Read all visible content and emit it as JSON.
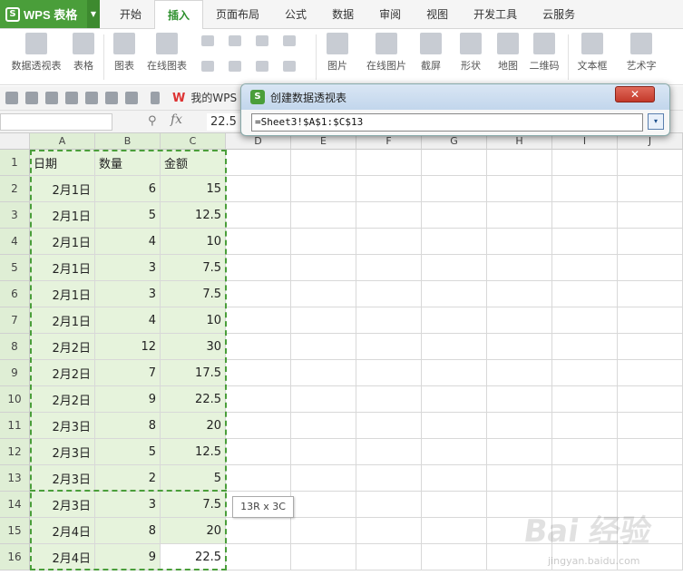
{
  "app": {
    "title": "WPS 表格",
    "logo_letter": "S"
  },
  "tabs": [
    "开始",
    "插入",
    "页面布局",
    "公式",
    "数据",
    "审阅",
    "视图",
    "开发工具",
    "云服务"
  ],
  "active_tab": "插入",
  "ribbon": {
    "pivot": "数据透视表",
    "table": "表格",
    "chart": "图表",
    "online_chart": "在线图表",
    "picture": "图片",
    "online_picture": "在线图片",
    "screenshot": "截屏",
    "shape": "形状",
    "map": "地图",
    "qrcode": "二维码",
    "textbox": "文本框",
    "wordart": "艺术字"
  },
  "quick_access": {
    "wps_tab": "我的WPS",
    "wps_mark": "W"
  },
  "formula_bar": {
    "fx": "fx",
    "value": "22.5"
  },
  "dialog": {
    "title": "创建数据透视表",
    "logo": "S",
    "range": "=Sheet3!$A$1:$C$13",
    "close": "✕",
    "collapse": "▾"
  },
  "tooltip": "13R x 3C",
  "columns": [
    "A",
    "B",
    "C",
    "D",
    "E",
    "F",
    "G",
    "H",
    "I",
    "J"
  ],
  "rows": [
    "1",
    "2",
    "3",
    "4",
    "5",
    "6",
    "7",
    "8",
    "9",
    "10",
    "11",
    "12",
    "13",
    "14",
    "15",
    "16"
  ],
  "table": {
    "headers": [
      "日期",
      "数量",
      "金额"
    ],
    "data": [
      [
        "2月1日",
        "6",
        "15"
      ],
      [
        "2月1日",
        "5",
        "12.5"
      ],
      [
        "2月1日",
        "4",
        "10"
      ],
      [
        "2月1日",
        "3",
        "7.5"
      ],
      [
        "2月1日",
        "3",
        "7.5"
      ],
      [
        "2月1日",
        "4",
        "10"
      ],
      [
        "2月2日",
        "12",
        "30"
      ],
      [
        "2月2日",
        "7",
        "17.5"
      ],
      [
        "2月2日",
        "9",
        "22.5"
      ],
      [
        "2月3日",
        "8",
        "20"
      ],
      [
        "2月3日",
        "5",
        "12.5"
      ],
      [
        "2月3日",
        "2",
        "5"
      ],
      [
        "2月3日",
        "3",
        "7.5"
      ],
      [
        "2月4日",
        "8",
        "20"
      ],
      [
        "2月4日",
        "9",
        "22.5"
      ]
    ]
  },
  "watermark": {
    "text": "Bai 经验",
    "url": "jingyan.baidu.com"
  },
  "colors": {
    "accent": "#4a9e3a",
    "selection_fill": "#e6f3dc"
  }
}
